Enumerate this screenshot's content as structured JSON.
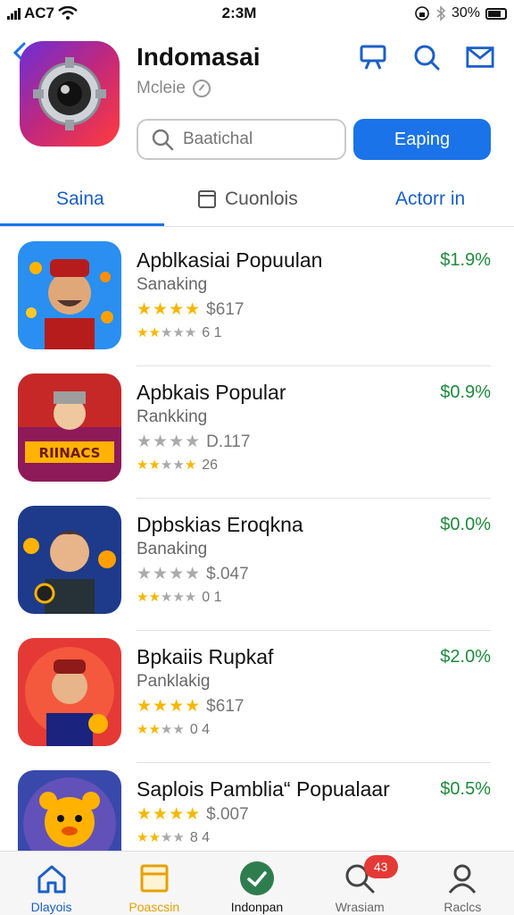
{
  "status_bar": {
    "carrier": "AC7",
    "time": "2:3M",
    "battery": "30%"
  },
  "header": {
    "title": "Indomasai",
    "subtitle": "Mcleie",
    "search_placeholder": "Baatichal",
    "primary_button": "Eaping"
  },
  "tabs": [
    {
      "label": "Saina"
    },
    {
      "label": "Cuonlois"
    },
    {
      "label": "Actorr in"
    }
  ],
  "apps": [
    {
      "name": "Apblkasiai Popuulan",
      "category": "Sanaking",
      "rating_text": "$617",
      "count": "6 1",
      "price": "$1.9%"
    },
    {
      "name": "Apbkais Popular",
      "category": "Rankking",
      "rating_text": "D.117",
      "count": "26",
      "price": "$0.9%"
    },
    {
      "name": "Dpbskias Eroqkna",
      "category": "Banaking",
      "rating_text": "$.047",
      "count": "0 1",
      "price": "$0.0%"
    },
    {
      "name": "Bpkaiis Rupkaf",
      "category": "Panklakig",
      "rating_text": "$617",
      "count": "0 4",
      "price": "$2.0%"
    },
    {
      "name": "Saplois Pamblia“ Popualaar",
      "category": "",
      "rating_text": "$.007",
      "count": "8 4",
      "price": "$0.5%"
    }
  ],
  "bottom_nav": [
    {
      "label": "Dlayois"
    },
    {
      "label": "Poascsin"
    },
    {
      "label": "Indonpan"
    },
    {
      "label": "Wrasiam",
      "badge": "43"
    },
    {
      "label": "Raclcs"
    }
  ],
  "colors": {
    "accent": "#1a73e8",
    "price": "#1e8a3c",
    "star": "#f5b700",
    "badge": "#e53935"
  }
}
